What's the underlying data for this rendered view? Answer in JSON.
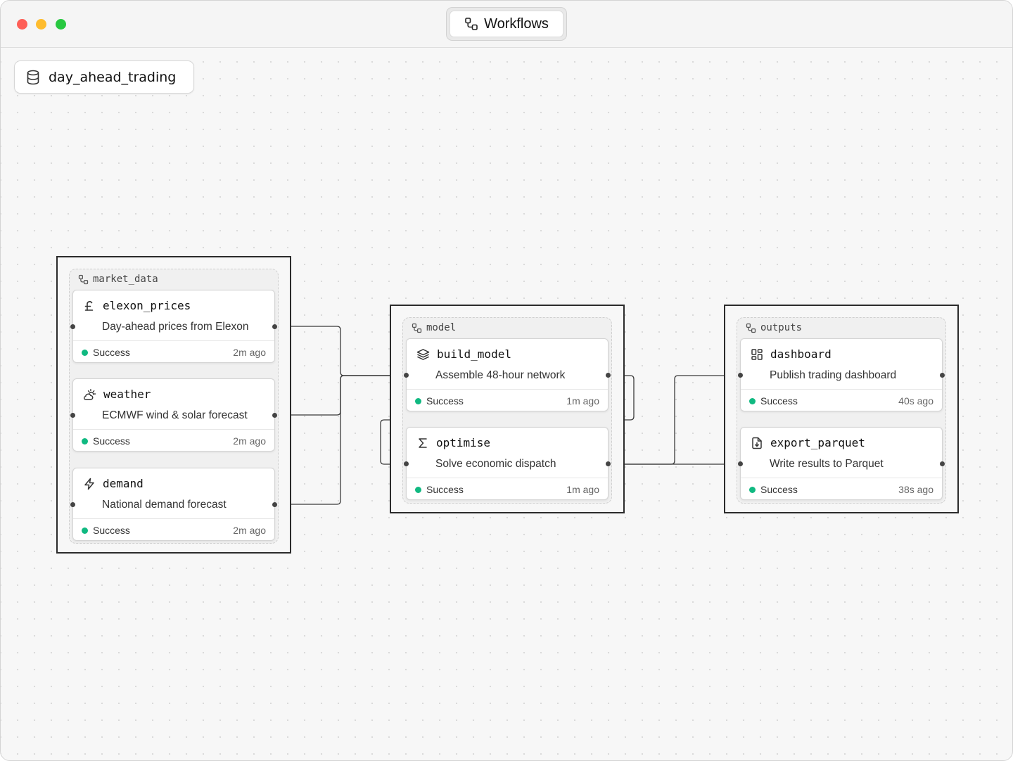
{
  "window": {
    "title": "Workflows",
    "title_icon": "workflow-icon"
  },
  "project": {
    "name": "day_ahead_trading",
    "icon": "database-icon"
  },
  "groups": {
    "market_data": {
      "label": "market_data",
      "nodes": {
        "elexon_prices": {
          "title": "elexon_prices",
          "icon": "pound-sterling-icon",
          "description": "Day-ahead prices from Elexon",
          "status": "Success",
          "time": "2m ago"
        },
        "weather": {
          "title": "weather",
          "icon": "cloud-sun-icon",
          "description": "ECMWF wind & solar forecast",
          "status": "Success",
          "time": "2m ago"
        },
        "demand": {
          "title": "demand",
          "icon": "zap-icon",
          "description": "National demand forecast",
          "status": "Success",
          "time": "2m ago"
        }
      }
    },
    "model": {
      "label": "model",
      "nodes": {
        "build_model": {
          "title": "build_model",
          "icon": "layers-icon",
          "description": "Assemble 48-hour network",
          "status": "Success",
          "time": "1m ago"
        },
        "optimise": {
          "title": "optimise",
          "icon": "sigma-icon",
          "description": "Solve economic dispatch",
          "status": "Success",
          "time": "1m ago"
        }
      }
    },
    "outputs": {
      "label": "outputs",
      "nodes": {
        "dashboard": {
          "title": "dashboard",
          "icon": "layout-grid-icon",
          "description": "Publish trading dashboard",
          "status": "Success",
          "time": "40s ago"
        },
        "export_parquet": {
          "title": "export_parquet",
          "icon": "file-download-icon",
          "description": "Write results to Parquet",
          "status": "Success",
          "time": "38s ago"
        }
      }
    }
  },
  "colors": {
    "success": "#10b981",
    "edge": "#3a3a3a",
    "group_border": "#2b2b2b"
  }
}
